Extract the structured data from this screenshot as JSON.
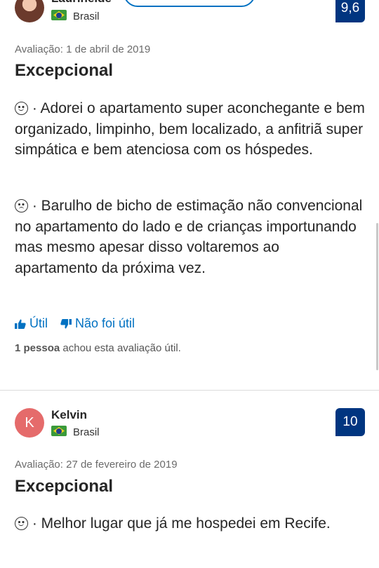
{
  "reviews": [
    {
      "reviewer_name": "Laurineide",
      "country": "Brasil",
      "score": "9,6",
      "date": "Avaliação: 1 de abril de 2019",
      "headline": "Excepcional",
      "positive": "· Adorei o apartamento super aconchegante e bem organizado, limpinho, bem localizado, a anfitriã super simpática e bem atenciosa com os hóspedes.",
      "negative": "· Barulho de bicho de estimação não convencional no apartamento do lado e de crianças importunando mas mesmo apesar disso voltaremos ao apartamento da próxima vez.",
      "helpful_label": "Útil",
      "not_helpful_label": "Não foi útil",
      "helpful_count_bold": "1 pessoa",
      "helpful_count_rest": " achou esta avaliação útil.",
      "avatar_icon": "person-photo"
    },
    {
      "reviewer_name": "Kelvin",
      "avatar_letter": "K",
      "country": "Brasil",
      "score": "10",
      "date": "Avaliação: 27 de fevereiro de 2019",
      "headline": "Excepcional",
      "positive": "· Melhor lugar que já me hospedei em Recife."
    }
  ],
  "colors": {
    "score_bg": "#003580",
    "link": "#0071c2",
    "avatar_letter_bg": "#e56b6b"
  }
}
